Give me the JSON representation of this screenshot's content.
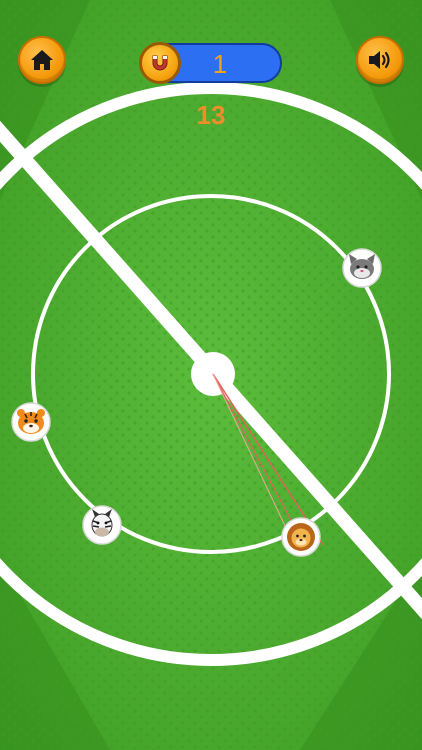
{
  "hud": {
    "home_button": {
      "icon": "home-icon"
    },
    "sound_button": {
      "icon": "speaker-icon"
    },
    "score": {
      "icon": "magnet-coin-icon",
      "value": "1"
    },
    "counter": "13"
  },
  "field": {
    "players": [
      {
        "animal": "cat",
        "icon": "cat-face-icon"
      },
      {
        "animal": "tiger",
        "icon": "tiger-face-icon"
      },
      {
        "animal": "zebra",
        "icon": "zebra-face-icon"
      },
      {
        "animal": "lion",
        "icon": "lion-face-icon"
      }
    ]
  },
  "colors": {
    "pitch": "#4aad2c",
    "pitch_dark": "#3a9420",
    "lines": "#ffffff",
    "button_orange": "#f59a0b",
    "score_blue": "#2d6ff2",
    "counter_orange": "#f08c2a"
  }
}
